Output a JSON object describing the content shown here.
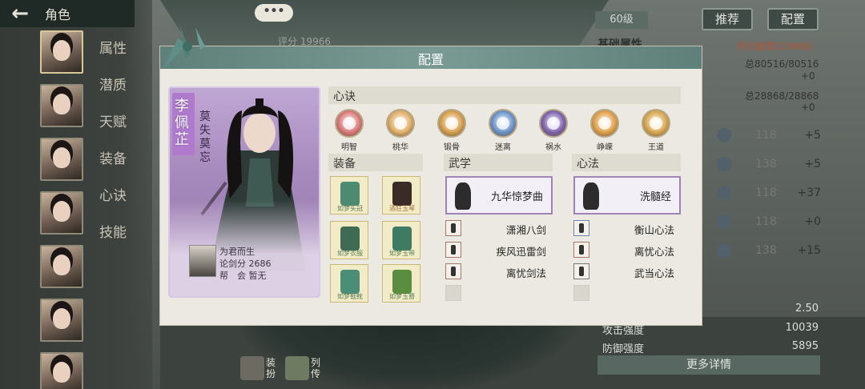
{
  "top_bar": {
    "back_icon": "arrow-left-icon",
    "title": "角色"
  },
  "bubble_label": "•••",
  "score_top": "评分 19966",
  "sidebar_menu": [
    "属性",
    "潜质",
    "天赋",
    "装备",
    "心诀",
    "技能"
  ],
  "right_panel": {
    "level": "60级",
    "recommend_btn": "推荐",
    "config_btn": "配置",
    "basic_attr_label": "基础属性",
    "pkg_label": "所向披靡(19966)",
    "hp": "总80516/80516",
    "hp_plus": "+0",
    "mp": "总28868/28868",
    "mp_plus": "+0",
    "stats": [
      {
        "lv": "118",
        "plus": "+5"
      },
      {
        "lv": "138",
        "plus": "+5"
      },
      {
        "lv": "118",
        "plus": "+37"
      },
      {
        "lv": "118",
        "plus": "+0"
      },
      {
        "lv": "138",
        "plus": "+15"
      }
    ],
    "value_250": "2.50",
    "attack_label": "攻击强度",
    "attack_value": "10039",
    "defense_label": "防御强度",
    "defense_value": "5895",
    "more_detail": "更多详情"
  },
  "bottom_buttons": {
    "dress": "装扮",
    "biography": "列传"
  },
  "modal": {
    "title": "配置",
    "character": {
      "name": "李佩芷",
      "motto": "莫失莫忘",
      "title_line": "为君而生",
      "score_line": "论剑分 2686",
      "guild_line": "帮　会 暂无"
    },
    "xinjue_label": "心诀",
    "xinjue": [
      {
        "label": "明智",
        "color": "#d9797a"
      },
      {
        "label": "桃华",
        "color": "#e0b068"
      },
      {
        "label": "锻骨",
        "color": "#d7a04d"
      },
      {
        "label": "迷离",
        "color": "#6a92c9"
      },
      {
        "label": "祸水",
        "color": "#7c63ad"
      },
      {
        "label": "峥嵘",
        "color": "#e0a149"
      },
      {
        "label": "王道",
        "color": "#d8a851"
      }
    ],
    "equip_label": "装备",
    "equipment": [
      {
        "name": "如梦头冠",
        "color": "#4d8a72"
      },
      {
        "name": "酒狂玉琴",
        "color": "#3a2b26"
      },
      {
        "name": "如梦衣服",
        "color": "#3f6b55"
      },
      {
        "name": "如梦玉带",
        "color": "#3f7b62"
      },
      {
        "name": "如梦鞋靴",
        "color": "#4a8e78"
      },
      {
        "name": "如梦玉簪",
        "color": "#5a8d3f"
      }
    ],
    "wuxue_label": "武学",
    "wuxue_main": "九华惊梦曲",
    "wuxue_list": [
      "潇湘八剑",
      "疾风迅雷剑",
      "离忧剑法"
    ],
    "xinfa_label": "心法",
    "xinfa_main": "洗髓经",
    "xinfa_list": [
      "衡山心法",
      "离忧心法",
      "武当心法"
    ]
  }
}
